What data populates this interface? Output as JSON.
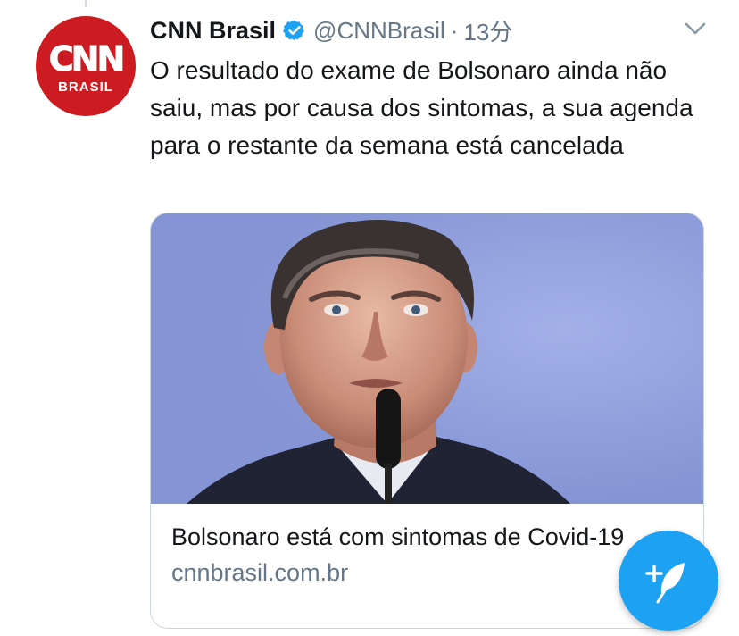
{
  "tweet": {
    "author": {
      "display_name": "CNN Brasil",
      "handle": "@CNNBrasil",
      "separator": "·",
      "time": "13分",
      "verified": true,
      "avatar_logo": "CNN",
      "avatar_subtitle": "BRASIL",
      "verified_icon": "verified-badge-icon"
    },
    "text": "O resultado do exame de Bolsonaro ainda não saiu, mas por causa dos sintomas, a sua agenda para o restante da semana está cancelada",
    "menu_icon": "chevron-down-icon"
  },
  "card": {
    "image_alt": "photo-of-man-at-microphone",
    "title": "Bolsonaro está com sintomas de Covid-19",
    "domain": "cnnbrasil.com.br"
  },
  "compose_button": {
    "icon": "compose-feather-icon"
  },
  "colors": {
    "brand_red": "#cc1c22",
    "twitter_blue": "#1da1f2",
    "text_primary": "#14171a",
    "text_secondary": "#657786",
    "card_border": "#ccd6dd"
  }
}
